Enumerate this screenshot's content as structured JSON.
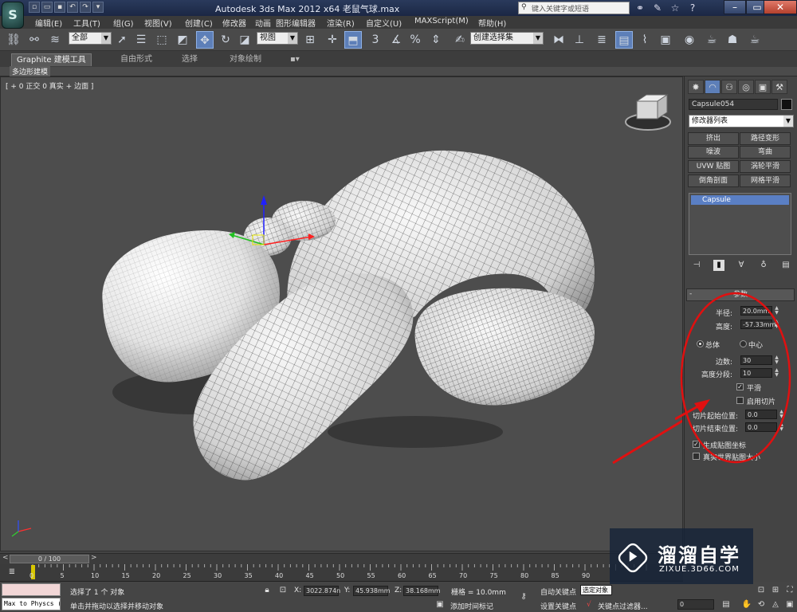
{
  "titlebar": {
    "logo": "S",
    "title": "Autodesk 3ds Max  2012 x64      老鼠气球.max",
    "search_placeholder": "键入关键字或短语",
    "win_minimize": "–",
    "win_restore": "▭",
    "win_close": "✕"
  },
  "menu": [
    "编辑(E)",
    "工具(T)",
    "组(G)",
    "视图(V)",
    "创建(C)",
    "修改器",
    "动画",
    "图形编辑器",
    "渲染(R)",
    "自定义(U)",
    "MAXScript(M)",
    "帮助(H)"
  ],
  "toolbar": {
    "filter": "全部",
    "ref_coord": "视图",
    "named_selection": "创建选择集",
    "snap_label": "3",
    "percent_label": "%"
  },
  "ribbon": {
    "tabs": [
      "Graphite 建模工具",
      "自由形式",
      "选择",
      "对象绘制"
    ],
    "active_tab": "Graphite 建模工具",
    "subtab": "多边形建模"
  },
  "viewport": {
    "label": "[ + 0 正交 0 真实 + 边面 ]",
    "background": "#4d4d4d"
  },
  "command_panel": {
    "object_name": "Capsule054",
    "modifier_list": "修改器列表",
    "modifier_buttons": [
      "挤出",
      "路径变形",
      "噪波",
      "弯曲",
      "UVW 贴图",
      "涡轮平滑",
      "倒角剖面",
      "网格平滑"
    ],
    "stack_item": "Capsule",
    "rollout_title": "参数",
    "params": {
      "radius_label": "半径:",
      "radius_value": "20.0mm",
      "height_label": "高度:",
      "height_value": "-57.33mm",
      "overall_label": "总体",
      "center_label": "中心",
      "sides_label": "边数:",
      "sides_value": "30",
      "height_segs_label": "高度分段:",
      "height_segs_value": "10",
      "smooth_label": "平滑",
      "smooth_checked": true,
      "slice_on_label": "启用切片",
      "slice_on_checked": false,
      "slice_from_label": "切片起始位置:",
      "slice_from_value": "0.0",
      "slice_to_label": "切片结束位置:",
      "slice_to_value": "0.0",
      "gen_map_label": "生成贴图坐标",
      "gen_map_checked": true,
      "real_world_label": "真实世界贴图大小",
      "real_world_checked": false
    }
  },
  "annotation": {
    "color": "#e01010"
  },
  "timeline": {
    "thumb": "0 / 100",
    "ticks": [
      "0",
      "5",
      "10",
      "15",
      "20",
      "25",
      "30",
      "35",
      "40",
      "45",
      "50",
      "55",
      "60",
      "65",
      "70",
      "75",
      "80",
      "85",
      "90"
    ]
  },
  "status": {
    "maxscript_text": "Max to Physcs (",
    "selected": "选择了 1 个 对象",
    "prompt": "单击并拖动以选择并移动对象",
    "x_label": "X:",
    "x_value": "3022.874n",
    "y_label": "Y:",
    "y_value": "45.938mm",
    "z_label": "Z:",
    "z_value": "38.168mm",
    "grid": "栅格 = 10.0mm",
    "add_time_tag": "添加时间标记",
    "auto_key": "自动关键点",
    "set_key": "设置关键点",
    "selection_set": "选定对象",
    "key_filters": "关键点过滤器...",
    "frame": "0"
  },
  "watermark": {
    "cn": "溜溜自学",
    "url": "ZIXUE.3D66.COM"
  }
}
